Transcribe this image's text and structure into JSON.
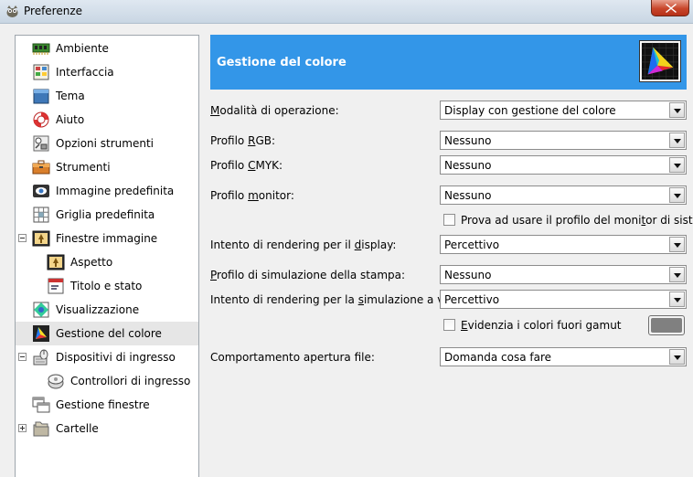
{
  "window": {
    "title": "Preferenze",
    "colors": {
      "titlebar": "#c9d6e3",
      "close": "#c8462b"
    }
  },
  "sidebar": {
    "items": [
      {
        "label": "Ambiente",
        "icon": "memory-chip-icon"
      },
      {
        "label": "Interfaccia",
        "icon": "interface-icon"
      },
      {
        "label": "Tema",
        "icon": "theme-icon"
      },
      {
        "label": "Aiuto",
        "icon": "lifebuoy-icon"
      },
      {
        "label": "Opzioni strumenti",
        "icon": "tool-options-icon"
      },
      {
        "label": "Strumenti",
        "icon": "toolbox-icon"
      },
      {
        "label": "Immagine predefinita",
        "icon": "default-image-icon"
      },
      {
        "label": "Griglia predefinita",
        "icon": "grid-icon"
      },
      {
        "label": "Finestre immagine",
        "icon": "image-window-icon",
        "expanded": true
      },
      {
        "label": "Aspetto",
        "icon": "appearance-icon"
      },
      {
        "label": "Titolo e stato",
        "icon": "title-status-icon"
      },
      {
        "label": "Visualizzazione",
        "icon": "display-icon"
      },
      {
        "label": "Gestione del colore",
        "icon": "color-management-icon",
        "selected": true
      },
      {
        "label": "Dispositivi di ingresso",
        "icon": "input-devices-icon",
        "expanded": true
      },
      {
        "label": "Controllori di ingresso",
        "icon": "input-controllers-icon"
      },
      {
        "label": "Gestione finestre",
        "icon": "window-management-icon"
      },
      {
        "label": "Cartelle",
        "icon": "folders-icon",
        "expanded": false
      }
    ]
  },
  "header": {
    "title": "Gestione del colore",
    "icon": "color-gamut-icon",
    "color": "#3396e8"
  },
  "form": {
    "mode": {
      "label_pre": "",
      "label_key": "M",
      "label_post": "odalità di operazione:",
      "value": "Display con gestione del colore"
    },
    "rgb": {
      "label_pre": "Profilo ",
      "label_key": "R",
      "label_post": "GB:",
      "value": "Nessuno"
    },
    "cmyk": {
      "label_pre": "Profilo ",
      "label_key": "C",
      "label_post": "MYK:",
      "value": "Nessuno"
    },
    "monitor": {
      "label_pre": "Profilo ",
      "label_key": "m",
      "label_post": "onitor:",
      "value": "Nessuno"
    },
    "system_profile": {
      "label_pre": "Prova ad usare il profilo del moni",
      "label_key": "t",
      "label_post": "or di sistema",
      "checked": false
    },
    "display_intent": {
      "label_pre": "Intento di rendering per il ",
      "label_key": "d",
      "label_post": "isplay:",
      "value": "Percettivo"
    },
    "print_sim": {
      "label_pre": "",
      "label_key": "P",
      "label_post": "rofilo di simulazione della stampa:",
      "value": "Nessuno"
    },
    "sim_intent": {
      "label_pre": "Intento di rendering per la ",
      "label_key": "s",
      "label_post": "imulazione a video:",
      "value": "Percettivo"
    },
    "out_of_gamut": {
      "label_pre": "",
      "label_key": "E",
      "label_post": "videnzia i colori fuori gamut",
      "checked": false,
      "color": "#808080"
    },
    "file_open": {
      "label_pre": "Comportamento apertura file:",
      "label_key": "",
      "label_post": "",
      "value": "Domanda cosa fare"
    }
  }
}
